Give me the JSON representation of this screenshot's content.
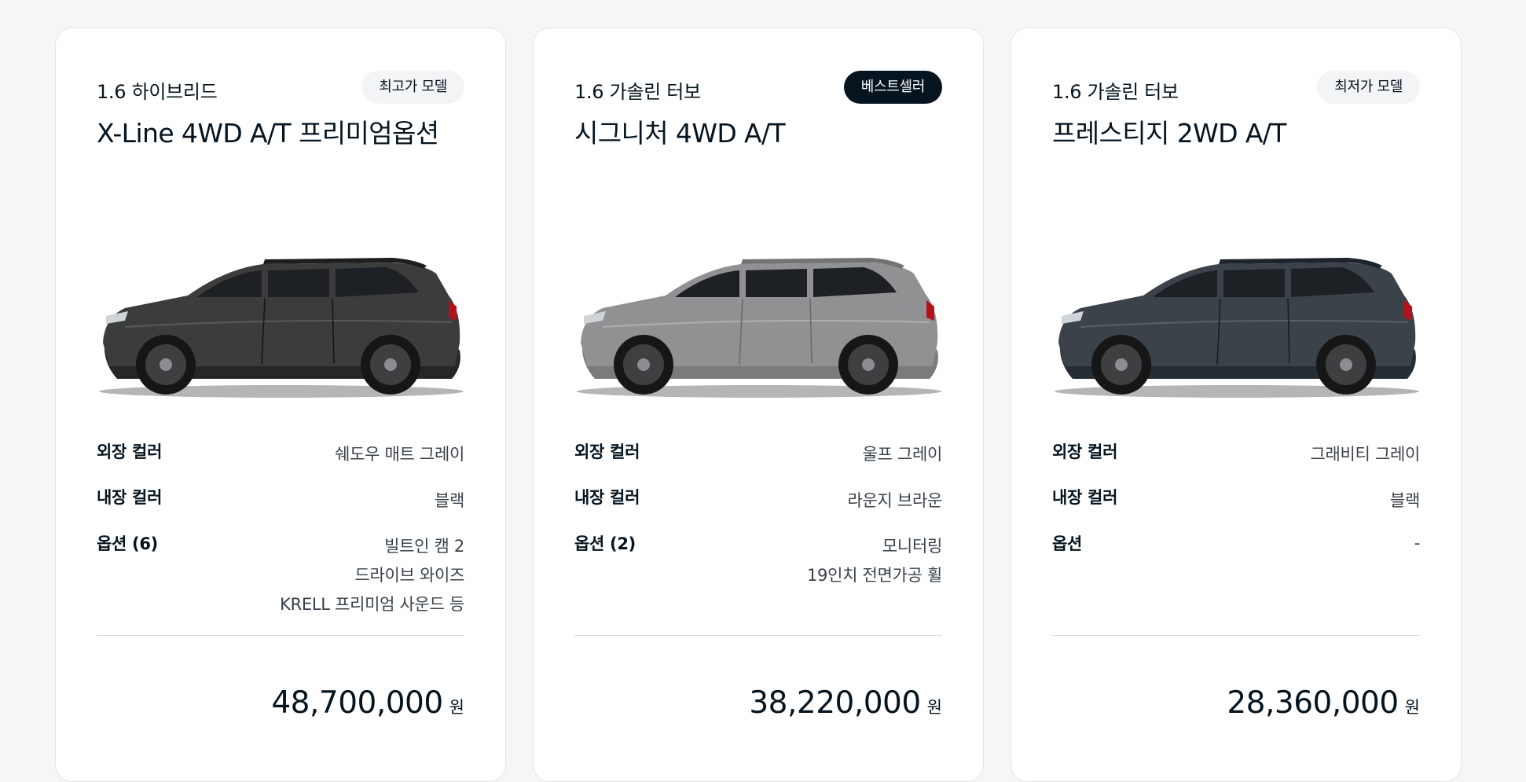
{
  "cards": [
    {
      "engine": "1.6 하이브리드",
      "badge": "최고가 모델",
      "trim": "X-Line 4WD A/T 프리미엄옵션",
      "car_color": "#3b3d3c",
      "exterior_label": "외장 컬러",
      "exterior_value": "쉐도우 매트 그레이",
      "interior_label": "내장 컬러",
      "interior_value": "블랙",
      "options_label": "옵션 (6)",
      "options": [
        "빌트인 캠 2",
        "드라이브 와이즈",
        "KRELL 프리미엄 사운드 등"
      ],
      "price": "48,700,000",
      "unit": "원"
    },
    {
      "engine": "1.6 가솔린 터보",
      "badge": "베스트셀러",
      "trim": "시그니처 4WD A/T",
      "car_color": "#8f9193",
      "exterior_label": "외장 컬러",
      "exterior_value": "울프 그레이",
      "interior_label": "내장 컬러",
      "interior_value": "라운지 브라운",
      "options_label": "옵션 (2)",
      "options": [
        "모니터링",
        "19인치 전면가공 휠"
      ],
      "price": "38,220,000",
      "unit": "원"
    },
    {
      "engine": "1.6 가솔린 터보",
      "badge": "최저가 모델",
      "trim": "프레스티지 2WD A/T",
      "car_color": "#3c424a",
      "exterior_label": "외장 컬러",
      "exterior_value": "그래비티 그레이",
      "interior_label": "내장 컬러",
      "interior_value": "블랙",
      "options_label": "옵션",
      "options": [
        "-"
      ],
      "price": "28,360,000",
      "unit": "원"
    }
  ],
  "colors": {
    "accent": "#05141f",
    "badge_light_bg": "#f3f4f6"
  }
}
